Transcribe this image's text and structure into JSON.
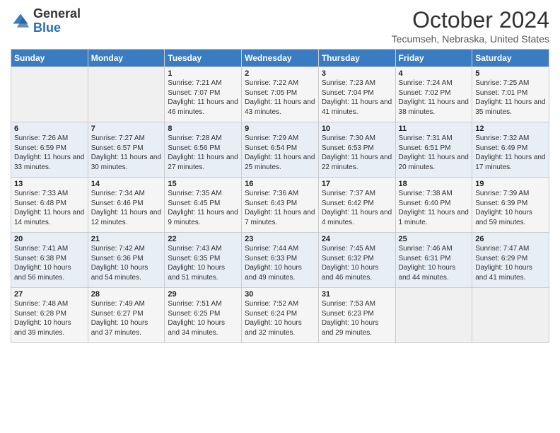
{
  "header": {
    "logo_general": "General",
    "logo_blue": "Blue",
    "month": "October 2024",
    "location": "Tecumseh, Nebraska, United States"
  },
  "days_of_week": [
    "Sunday",
    "Monday",
    "Tuesday",
    "Wednesday",
    "Thursday",
    "Friday",
    "Saturday"
  ],
  "weeks": [
    [
      {
        "day": "",
        "info": ""
      },
      {
        "day": "",
        "info": ""
      },
      {
        "day": "1",
        "info": "Sunrise: 7:21 AM\nSunset: 7:07 PM\nDaylight: 11 hours and 46 minutes."
      },
      {
        "day": "2",
        "info": "Sunrise: 7:22 AM\nSunset: 7:05 PM\nDaylight: 11 hours and 43 minutes."
      },
      {
        "day": "3",
        "info": "Sunrise: 7:23 AM\nSunset: 7:04 PM\nDaylight: 11 hours and 41 minutes."
      },
      {
        "day": "4",
        "info": "Sunrise: 7:24 AM\nSunset: 7:02 PM\nDaylight: 11 hours and 38 minutes."
      },
      {
        "day": "5",
        "info": "Sunrise: 7:25 AM\nSunset: 7:01 PM\nDaylight: 11 hours and 35 minutes."
      }
    ],
    [
      {
        "day": "6",
        "info": "Sunrise: 7:26 AM\nSunset: 6:59 PM\nDaylight: 11 hours and 33 minutes."
      },
      {
        "day": "7",
        "info": "Sunrise: 7:27 AM\nSunset: 6:57 PM\nDaylight: 11 hours and 30 minutes."
      },
      {
        "day": "8",
        "info": "Sunrise: 7:28 AM\nSunset: 6:56 PM\nDaylight: 11 hours and 27 minutes."
      },
      {
        "day": "9",
        "info": "Sunrise: 7:29 AM\nSunset: 6:54 PM\nDaylight: 11 hours and 25 minutes."
      },
      {
        "day": "10",
        "info": "Sunrise: 7:30 AM\nSunset: 6:53 PM\nDaylight: 11 hours and 22 minutes."
      },
      {
        "day": "11",
        "info": "Sunrise: 7:31 AM\nSunset: 6:51 PM\nDaylight: 11 hours and 20 minutes."
      },
      {
        "day": "12",
        "info": "Sunrise: 7:32 AM\nSunset: 6:49 PM\nDaylight: 11 hours and 17 minutes."
      }
    ],
    [
      {
        "day": "13",
        "info": "Sunrise: 7:33 AM\nSunset: 6:48 PM\nDaylight: 11 hours and 14 minutes."
      },
      {
        "day": "14",
        "info": "Sunrise: 7:34 AM\nSunset: 6:46 PM\nDaylight: 11 hours and 12 minutes."
      },
      {
        "day": "15",
        "info": "Sunrise: 7:35 AM\nSunset: 6:45 PM\nDaylight: 11 hours and 9 minutes."
      },
      {
        "day": "16",
        "info": "Sunrise: 7:36 AM\nSunset: 6:43 PM\nDaylight: 11 hours and 7 minutes."
      },
      {
        "day": "17",
        "info": "Sunrise: 7:37 AM\nSunset: 6:42 PM\nDaylight: 11 hours and 4 minutes."
      },
      {
        "day": "18",
        "info": "Sunrise: 7:38 AM\nSunset: 6:40 PM\nDaylight: 11 hours and 1 minute."
      },
      {
        "day": "19",
        "info": "Sunrise: 7:39 AM\nSunset: 6:39 PM\nDaylight: 10 hours and 59 minutes."
      }
    ],
    [
      {
        "day": "20",
        "info": "Sunrise: 7:41 AM\nSunset: 6:38 PM\nDaylight: 10 hours and 56 minutes."
      },
      {
        "day": "21",
        "info": "Sunrise: 7:42 AM\nSunset: 6:36 PM\nDaylight: 10 hours and 54 minutes."
      },
      {
        "day": "22",
        "info": "Sunrise: 7:43 AM\nSunset: 6:35 PM\nDaylight: 10 hours and 51 minutes."
      },
      {
        "day": "23",
        "info": "Sunrise: 7:44 AM\nSunset: 6:33 PM\nDaylight: 10 hours and 49 minutes."
      },
      {
        "day": "24",
        "info": "Sunrise: 7:45 AM\nSunset: 6:32 PM\nDaylight: 10 hours and 46 minutes."
      },
      {
        "day": "25",
        "info": "Sunrise: 7:46 AM\nSunset: 6:31 PM\nDaylight: 10 hours and 44 minutes."
      },
      {
        "day": "26",
        "info": "Sunrise: 7:47 AM\nSunset: 6:29 PM\nDaylight: 10 hours and 41 minutes."
      }
    ],
    [
      {
        "day": "27",
        "info": "Sunrise: 7:48 AM\nSunset: 6:28 PM\nDaylight: 10 hours and 39 minutes."
      },
      {
        "day": "28",
        "info": "Sunrise: 7:49 AM\nSunset: 6:27 PM\nDaylight: 10 hours and 37 minutes."
      },
      {
        "day": "29",
        "info": "Sunrise: 7:51 AM\nSunset: 6:25 PM\nDaylight: 10 hours and 34 minutes."
      },
      {
        "day": "30",
        "info": "Sunrise: 7:52 AM\nSunset: 6:24 PM\nDaylight: 10 hours and 32 minutes."
      },
      {
        "day": "31",
        "info": "Sunrise: 7:53 AM\nSunset: 6:23 PM\nDaylight: 10 hours and 29 minutes."
      },
      {
        "day": "",
        "info": ""
      },
      {
        "day": "",
        "info": ""
      }
    ]
  ]
}
